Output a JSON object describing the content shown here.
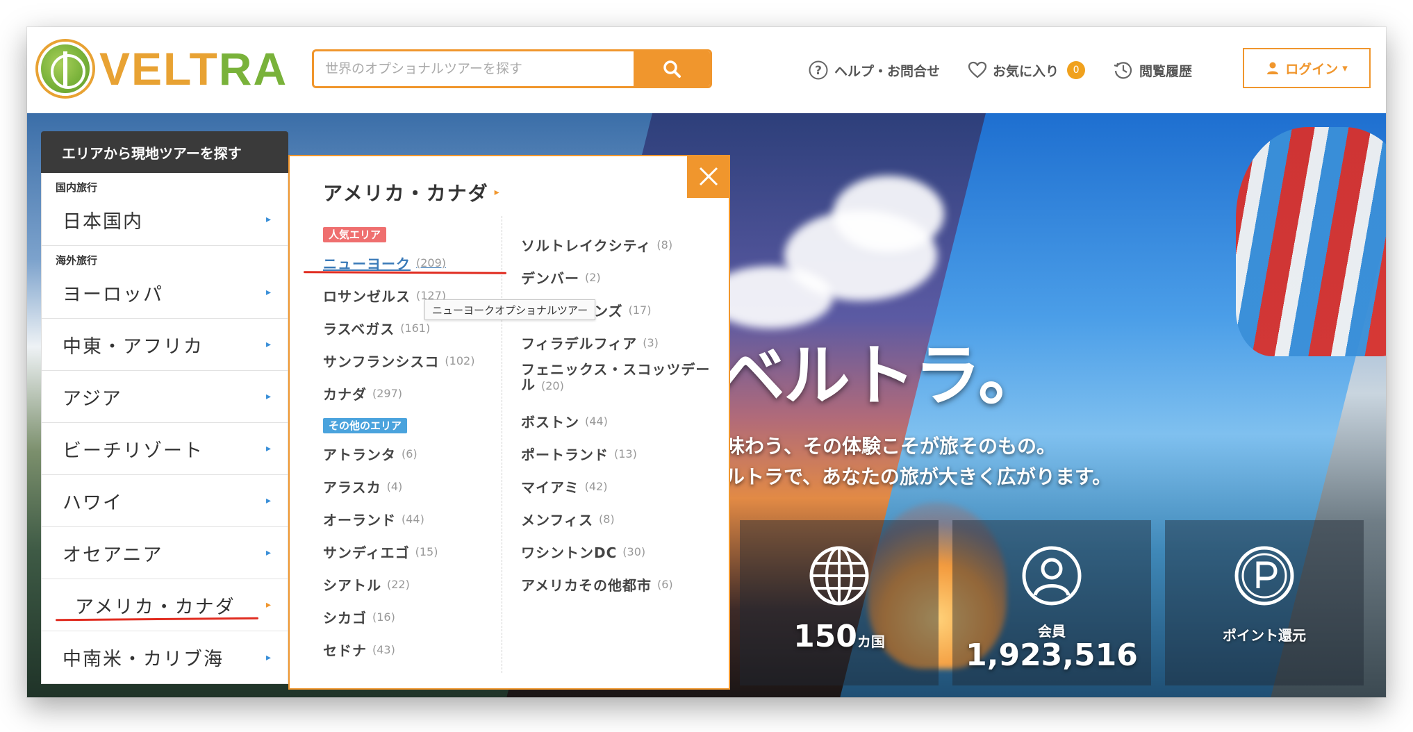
{
  "header": {
    "logo_text_a": "VELT",
    "logo_text_b": "RA",
    "search_placeholder": "世界のオプショナルツアーを探す",
    "help_label": "ヘルプ・お問合せ",
    "favorites_label": "お気に入り",
    "favorites_count": "0",
    "history_label": "閲覧履歴",
    "login_label": "ログイン",
    "login_arrow": "▾"
  },
  "area_menu": {
    "title": "エリアから現地ツアーを探す",
    "domestic_label": "国内旅行",
    "domestic_items": [
      {
        "label": "日本国内"
      }
    ],
    "overseas_label": "海外旅行",
    "overseas_items": [
      {
        "label": "ヨーロッパ"
      },
      {
        "label": "中東・アフリカ"
      },
      {
        "label": "アジア"
      },
      {
        "label": "ビーチリゾート"
      },
      {
        "label": "ハワイ"
      },
      {
        "label": "オセアニア"
      },
      {
        "label": "アメリカ・カナダ"
      },
      {
        "label": "中南米・カリブ海"
      }
    ],
    "chevron": "▸"
  },
  "region_panel": {
    "title": "アメリカ・カナダ",
    "title_arrow": "▸",
    "popular_tag": "人気エリア",
    "other_tag": "その他のエリア",
    "popular_cities": [
      {
        "name": "ニューヨーク",
        "count": "(209)"
      },
      {
        "name": "ロサンゼルス",
        "count": "(127)"
      },
      {
        "name": "ラスベガス",
        "count": "(161)"
      },
      {
        "name": "サンフランシスコ",
        "count": "(102)"
      },
      {
        "name": "カナダ",
        "count": "(297)"
      }
    ],
    "other_cities_col1": [
      {
        "name": "アトランタ",
        "count": "(6)"
      },
      {
        "name": "アラスカ",
        "count": "(4)"
      },
      {
        "name": "オーランド",
        "count": "(44)"
      },
      {
        "name": "サンディエゴ",
        "count": "(15)"
      },
      {
        "name": "シアトル",
        "count": "(22)"
      },
      {
        "name": "シカゴ",
        "count": "(16)"
      },
      {
        "name": "セドナ",
        "count": "(43)"
      }
    ],
    "col2_cities": [
      {
        "name": "ソルトレイクシティ",
        "count": "(8)"
      },
      {
        "name": "デンバー",
        "count": "(2)"
      },
      {
        "name": "ニューオリンズ",
        "count": "(17)"
      },
      {
        "name": "フィラデルフィア",
        "count": "(3)"
      },
      {
        "name": "フェニックス・スコッツデール",
        "count": "(20)"
      },
      {
        "name": "ボストン",
        "count": "(44)"
      },
      {
        "name": "ポートランド",
        "count": "(13)"
      },
      {
        "name": "マイアミ",
        "count": "(42)"
      },
      {
        "name": "メンフィス",
        "count": "(8)"
      },
      {
        "name": "ワシントンDC",
        "count": "(30)"
      },
      {
        "name": "アメリカその他都市",
        "count": "(6)"
      }
    ],
    "tooltip": "ニューヨークオプショナルツアー"
  },
  "hero": {
    "headline": "ベルトラ。",
    "sub_line1": "味わう、その体験こそが旅そのもの。",
    "sub_line2": "ルトラで、あなたの旅が大きく広がります。",
    "stat_countries_value": "150",
    "stat_countries_unit": "カ国",
    "stat_members_label": "会員",
    "stat_members_value": "1,923,516",
    "stat_points_label": "ポイント還元"
  },
  "colors": {
    "accent": "#f0962d",
    "link": "#3a7ab8",
    "popular_tag": "#ef6f6f",
    "other_tag": "#4aa3dd",
    "brand_green": "#79b23a"
  }
}
